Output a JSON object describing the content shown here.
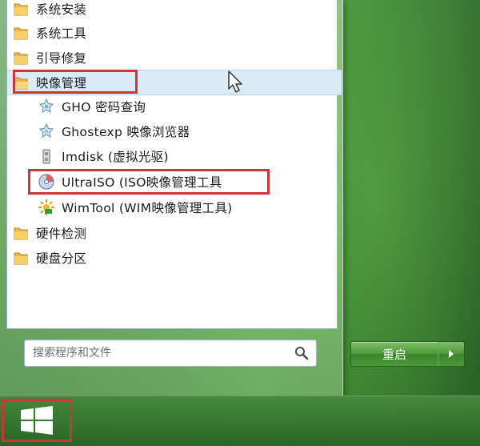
{
  "start_menu": {
    "programs": [
      {
        "label": "系统安装",
        "type": "folder"
      },
      {
        "label": "系统工具",
        "type": "folder"
      },
      {
        "label": "引导修复",
        "type": "folder"
      },
      {
        "label": "映像管理",
        "type": "folder",
        "selected": true
      },
      {
        "label": "GHO 密码查询",
        "type": "app",
        "icon": "gho-key-icon"
      },
      {
        "label": "Ghostexp 映像浏览器",
        "type": "app",
        "icon": "ghostexp-icon"
      },
      {
        "label": "Imdisk (虚拟光驱)",
        "type": "app",
        "icon": "imdisk-icon"
      },
      {
        "label": "UltraISO (ISO映像管理工具",
        "type": "app",
        "icon": "ultraiso-disc-icon"
      },
      {
        "label": "WimTool (WIM映像管理工具)",
        "type": "app",
        "icon": "wimtool-icon"
      },
      {
        "label": "硬件检测",
        "type": "folder"
      },
      {
        "label": "硬盘分区",
        "type": "folder"
      }
    ],
    "search": {
      "placeholder": "搜索程序和文件",
      "value": ""
    },
    "shutdown_label": "重启"
  },
  "colors": {
    "highlight_red": "#c8383b",
    "selected_bg": "#dbeaf7",
    "desktop_green": "#3c8f33"
  }
}
